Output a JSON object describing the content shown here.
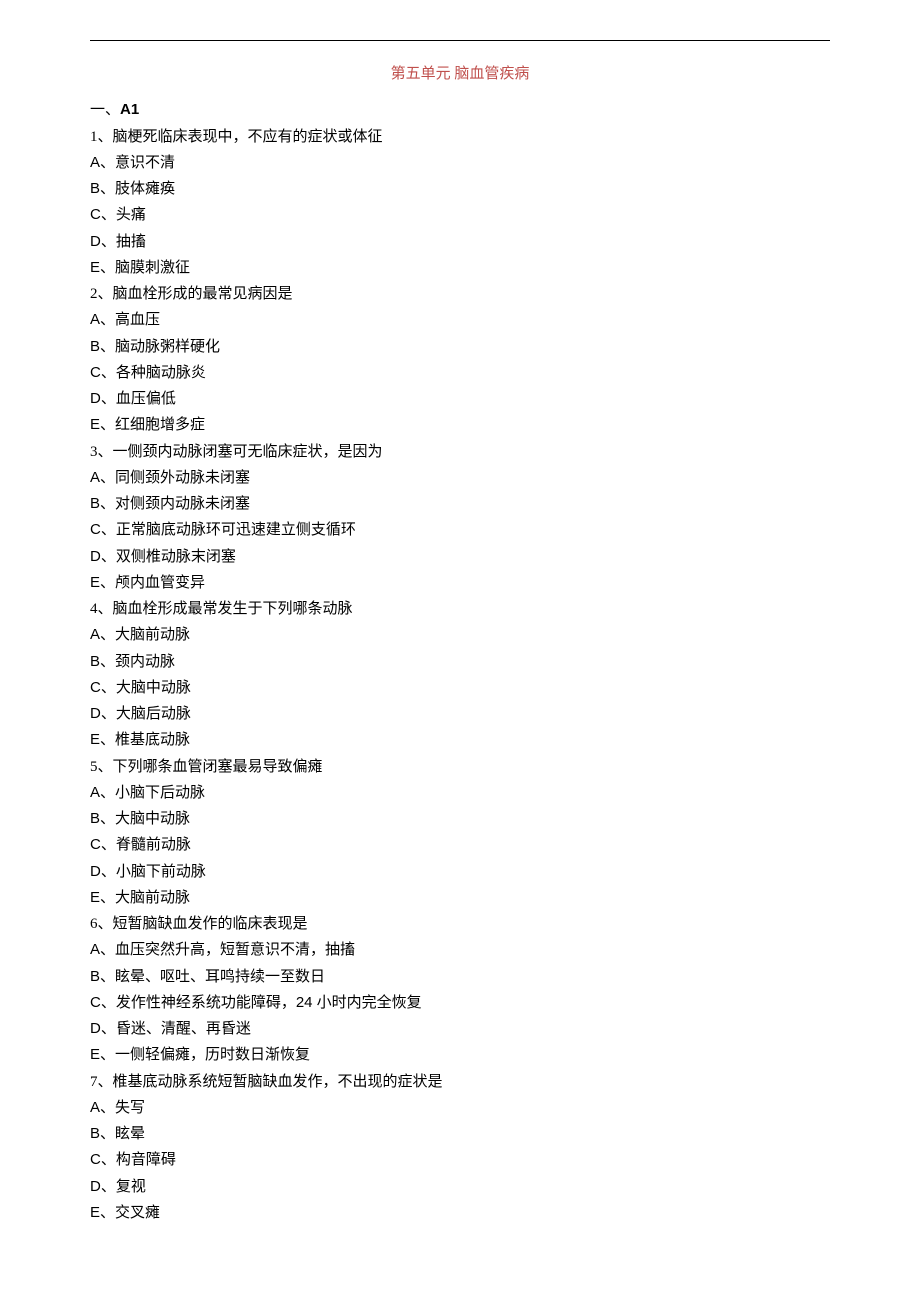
{
  "title": "第五单元  脑血管疾病",
  "section": {
    "prefix": "一、",
    "label": "A1"
  },
  "questions": [
    {
      "num": "1",
      "text": "脑梗死临床表现中，不应有的症状或体征",
      "options": [
        {
          "letter": "A",
          "text": "意识不清"
        },
        {
          "letter": "B",
          "text": "肢体瘫痪"
        },
        {
          "letter": "C",
          "text": "头痛"
        },
        {
          "letter": "D",
          "text": "抽搐"
        },
        {
          "letter": "E",
          "text": "脑膜刺激征"
        }
      ]
    },
    {
      "num": "2",
      "text": "脑血栓形成的最常见病因是",
      "options": [
        {
          "letter": "A",
          "text": "高血压"
        },
        {
          "letter": "B",
          "text": "脑动脉粥样硬化"
        },
        {
          "letter": "C",
          "text": "各种脑动脉炎"
        },
        {
          "letter": "D",
          "text": "血压偏低"
        },
        {
          "letter": "E",
          "text": "红细胞增多症"
        }
      ]
    },
    {
      "num": "3",
      "text": "一侧颈内动脉闭塞可无临床症状，是因为",
      "options": [
        {
          "letter": "A",
          "text": "同侧颈外动脉未闭塞"
        },
        {
          "letter": "B",
          "text": "对侧颈内动脉未闭塞"
        },
        {
          "letter": "C",
          "text": "正常脑底动脉环可迅速建立侧支循环"
        },
        {
          "letter": "D",
          "text": "双侧椎动脉末闭塞"
        },
        {
          "letter": "E",
          "text": "颅内血管变异"
        }
      ]
    },
    {
      "num": "4",
      "text": "脑血栓形成最常发生于下列哪条动脉",
      "options": [
        {
          "letter": "A",
          "text": "大脑前动脉"
        },
        {
          "letter": "B",
          "text": "颈内动脉"
        },
        {
          "letter": "C",
          "text": "大脑中动脉"
        },
        {
          "letter": "D",
          "text": "大脑后动脉"
        },
        {
          "letter": "E",
          "text": "椎基底动脉"
        }
      ]
    },
    {
      "num": "5",
      "text": "下列哪条血管闭塞最易导致偏瘫",
      "options": [
        {
          "letter": "A",
          "text": "小脑下后动脉"
        },
        {
          "letter": "B",
          "text": "大脑中动脉"
        },
        {
          "letter": "C",
          "text": "脊髓前动脉"
        },
        {
          "letter": "D",
          "text": "小脑下前动脉"
        },
        {
          "letter": "E",
          "text": "大脑前动脉"
        }
      ]
    },
    {
      "num": "6",
      "text": "短暂脑缺血发作的临床表现是",
      "options": [
        {
          "letter": "A",
          "text": "血压突然升高，短暂意识不清，抽搐"
        },
        {
          "letter": "B",
          "text": "眩晕、呕吐、耳鸣持续一至数日"
        },
        {
          "letter": "C",
          "text": "发作性神经系统功能障碍，24 小时内完全恢复"
        },
        {
          "letter": "D",
          "text": "昏迷、清醒、再昏迷"
        },
        {
          "letter": "E",
          "text": "一侧轻偏瘫，历时数日渐恢复"
        }
      ]
    },
    {
      "num": "7",
      "text": "椎基底动脉系统短暂脑缺血发作，不出现的症状是",
      "options": [
        {
          "letter": "A",
          "text": "失写"
        },
        {
          "letter": "B",
          "text": "眩晕"
        },
        {
          "letter": "C",
          "text": "构音障碍"
        },
        {
          "letter": "D",
          "text": "复视"
        },
        {
          "letter": "E",
          "text": "交叉瘫"
        }
      ]
    }
  ]
}
